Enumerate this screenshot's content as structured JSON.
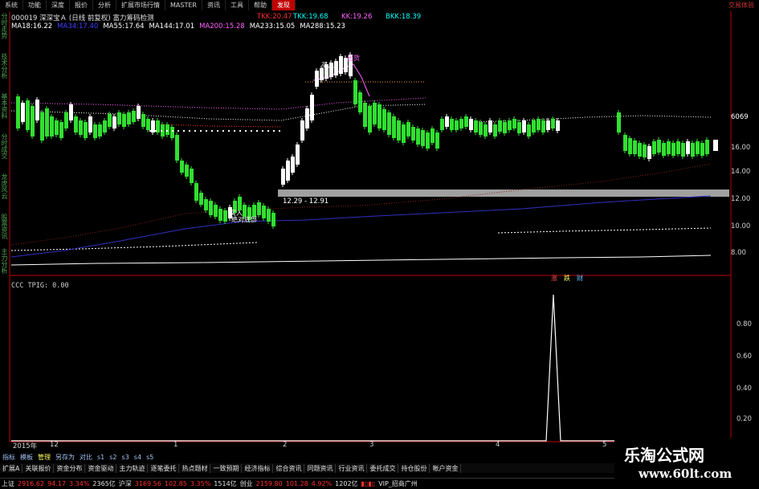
{
  "menu": {
    "items": [
      "系统",
      "功能",
      "深度",
      "报价",
      "分析",
      "扩展市场行情",
      "MASTER",
      "资讯",
      "工具",
      "帮助",
      "发现"
    ],
    "active_index": 10,
    "brand": "交易体验"
  },
  "sidebar_tabs": [
    "分时走势",
    "技术分析",
    "基本资料",
    "分时成交",
    "龙虎风云",
    "股票资讯",
    "主力分析"
  ],
  "stock": {
    "code": "000019",
    "name": "深深宝Ａ",
    "period": "(日线",
    "adjust": "前复权)",
    "indicator": "富力筹码检测"
  },
  "quotes": [
    {
      "label": "TKK:",
      "value": "20.47",
      "color": "#ff3030"
    },
    {
      "label": "TKK:",
      "value": "19.68",
      "color": "#00ffff"
    },
    {
      "label": "KK:",
      "value": "19.26",
      "color": "#ff60ff"
    },
    {
      "label": "BKK:",
      "value": "18.39",
      "color": "#00ffff"
    }
  ],
  "ma_values": [
    {
      "label": "MA18:",
      "value": "16.22",
      "color": "#ffffff"
    },
    {
      "label": "MA34:",
      "value": "17.40",
      "color": "#4040ff"
    },
    {
      "label": "MA55:",
      "value": "17.64",
      "color": "#ffffff"
    },
    {
      "label": "MA144:",
      "value": "17.01",
      "color": "#ffffff"
    },
    {
      "label": "MA200:",
      "value": "15.28",
      "color": "#ff60ff"
    },
    {
      "label": "MA233:",
      "value": "15.05",
      "color": "#ffffff"
    },
    {
      "label": "MA288:",
      "value": "15.23",
      "color": "#ffffff"
    }
  ],
  "price_axis": [
    "6069",
    "16.00",
    "14.00",
    "12.00",
    "10.00",
    "8.00"
  ],
  "chart_annotations": {
    "buy_signal": "买入",
    "bottom_label": "绝对底部",
    "sell_signal": "出货",
    "buy_signal_top": "买入",
    "range_label": "12.29 - 12.91"
  },
  "indicator_panel": {
    "label": "CCC TPIG: 0.00",
    "buttons": [
      "涨",
      "跌",
      "财"
    ],
    "axis": [
      "0.80",
      "0.60",
      "0.40",
      "0.20"
    ]
  },
  "time_axis": [
    "2015年",
    "12",
    "1",
    "2",
    "3",
    "4",
    "5"
  ],
  "bottom_tabs": [
    "指标",
    "模板",
    "管理",
    "另存为",
    "对比",
    "s1",
    "s2",
    "s3",
    "s4",
    "s5"
  ],
  "bottom_tab_selected": 2,
  "period_tabs": [
    "扩展A",
    "关联报价",
    "资金分布",
    "资金驱动",
    "主力轨迹",
    "逐笔委托",
    "热点题材",
    "一致预期",
    "经济指标",
    "综合资讯",
    "同题资讯",
    "行业资讯",
    "委托成交",
    "持仓股份",
    "帐户资金"
  ],
  "status": {
    "sh_label": "上证",
    "sh_value": "2916.62",
    "sh_change": "94.17",
    "sh_pct": "3.34%",
    "sh_amount": "2365亿",
    "hs_label": "沪深",
    "hs_value": "3169.56",
    "hs_change": "102.85",
    "hs_pct": "3.35%",
    "hs_amount": "1514亿",
    "cy_label": "创业",
    "cy_value": "2159.80",
    "cy_change": "101.28",
    "cy_pct": "4.92%",
    "cy_amount": "1202亿",
    "vip": "VIP_招商广州"
  },
  "watermark": {
    "title": "乐淘公式网",
    "url": "www.60lt.com"
  },
  "colors": {
    "up": "#ff3030",
    "down": "#30e030",
    "neutral": "#ffffff",
    "grid": "#c00000"
  }
}
